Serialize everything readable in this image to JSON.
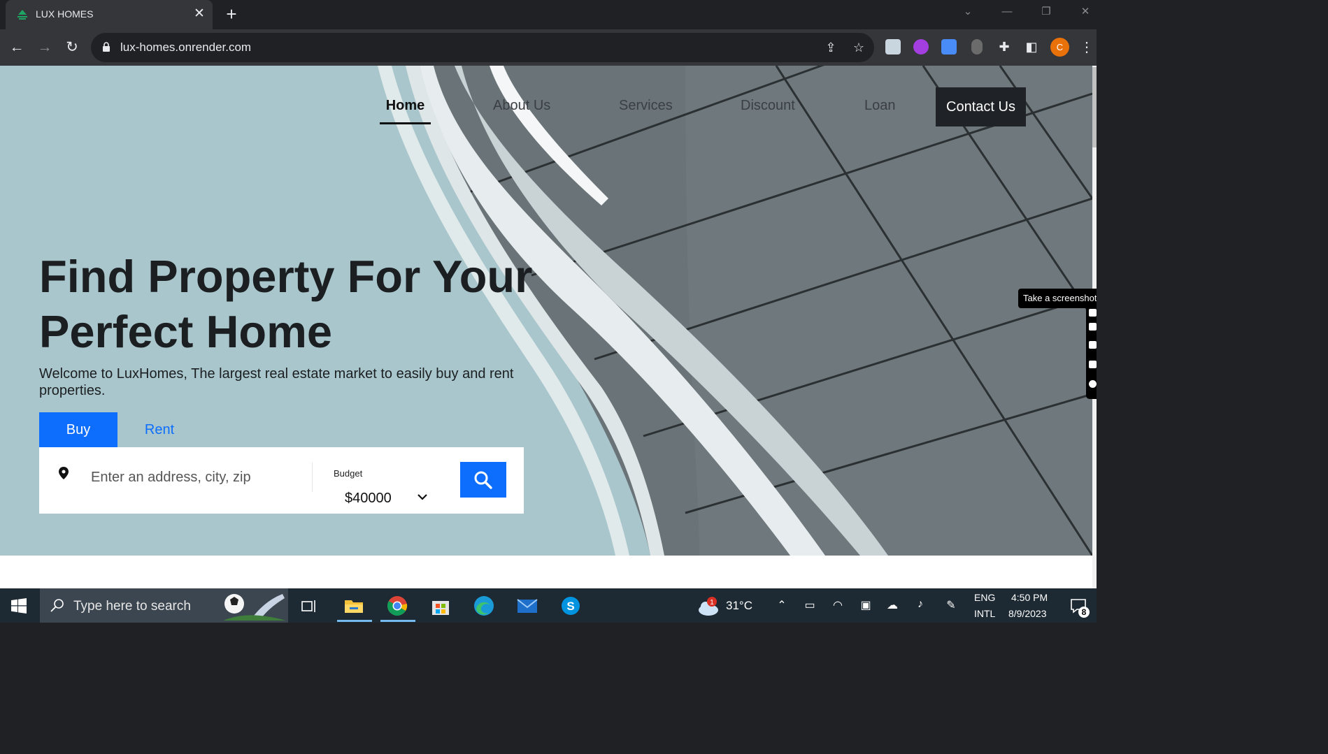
{
  "browser": {
    "tab_title": "LUX HOMES",
    "tab_close": "✕",
    "new_tab": "+",
    "url": "lux-homes.onrender.com",
    "profile_initial": "C"
  },
  "site": {
    "nav": {
      "home": "Home",
      "about": "About Us",
      "services": "Services",
      "discount": "Discount",
      "loan": "Loan",
      "contact": "Contact Us"
    },
    "hero": {
      "headline_line1": "Find Property For Your",
      "headline_line2": "Perfect Home",
      "subtitle": "Welcome to LuxHomes, The largest real estate market to easily buy and rent properties."
    },
    "search": {
      "tab_buy": "Buy",
      "tab_rent": "Rent",
      "address_placeholder": "Enter an address, city, zip",
      "budget_label": "Budget",
      "budget_value": "$40000"
    },
    "colors": {
      "accent": "#0d6efd",
      "hero_bg": "#a8c6cc",
      "contact_bg": "#1f2226"
    }
  },
  "overlay": {
    "screenshot_tooltip": "Take a screenshot"
  },
  "taskbar": {
    "search_placeholder": "Type here to search",
    "weather_temp": "31°C",
    "weather_badge": "1",
    "lang_line1": "ENG",
    "lang_line2": "INTL",
    "time": "4:50 PM",
    "date": "8/9/2023",
    "notification_count": "8"
  }
}
